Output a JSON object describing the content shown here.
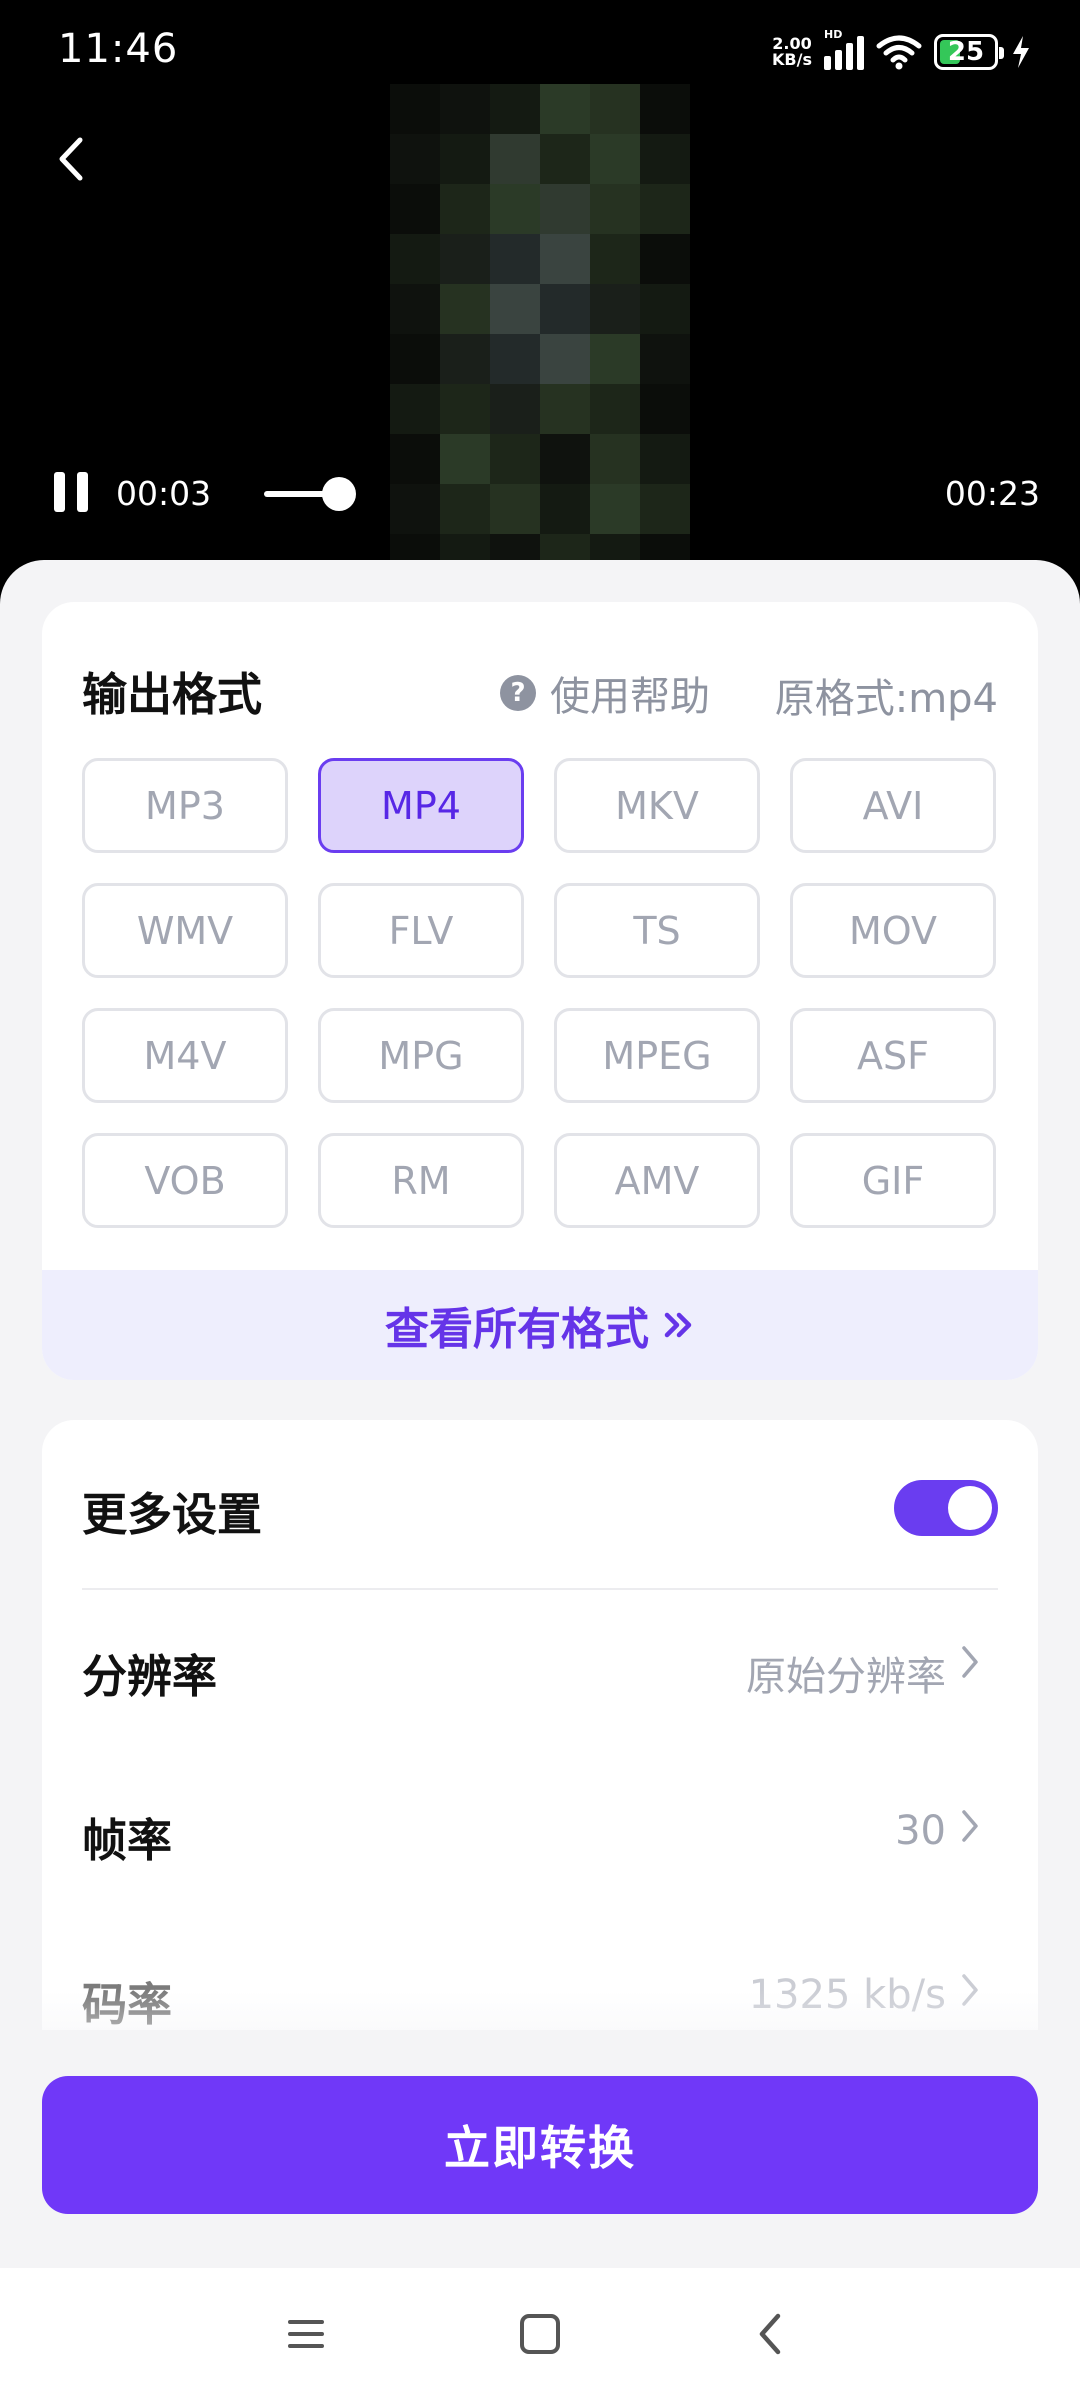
{
  "status_bar": {
    "time": "11:46",
    "net_speed_value": "2.00",
    "net_speed_unit": "KB/s",
    "network_badge": "HD",
    "battery_level": "25",
    "icons": [
      "signal-icon",
      "wifi-icon",
      "battery-icon",
      "charging-icon"
    ]
  },
  "player": {
    "current_time": "00:03",
    "total_time": "00:23",
    "progress_fraction": 0.13,
    "state": "playing",
    "icons": [
      "back-arrow-icon",
      "pause-icon"
    ]
  },
  "format_section": {
    "title": "输出格式",
    "help_label": "使用帮助",
    "original_format": "原格式:mp4",
    "formats": [
      "MP3",
      "MP4",
      "MKV",
      "AVI",
      "WMV",
      "FLV",
      "TS",
      "MOV",
      "M4V",
      "MPG",
      "MPEG",
      "ASF",
      "VOB",
      "RM",
      "AMV",
      "GIF"
    ],
    "selected_format": "MP4",
    "view_all_label": "查看所有格式",
    "view_all_icon": "double-chevron-right-icon"
  },
  "settings_section": {
    "title": "更多设置",
    "more_settings_enabled": true,
    "rows": [
      {
        "label": "分辨率",
        "value": "原始分辨率"
      },
      {
        "label": "帧率",
        "value": "30"
      },
      {
        "label": "码率",
        "value": "1325 kb/s"
      }
    ]
  },
  "actions": {
    "convert_label": "立即转换"
  },
  "colors": {
    "accent": "#7038f8",
    "selected_bg": "#ddd3fb",
    "muted_text": "#a2a6b2"
  },
  "nav_bar": {
    "icons": [
      "menu-icon",
      "home-square-icon",
      "back-nav-icon"
    ]
  }
}
